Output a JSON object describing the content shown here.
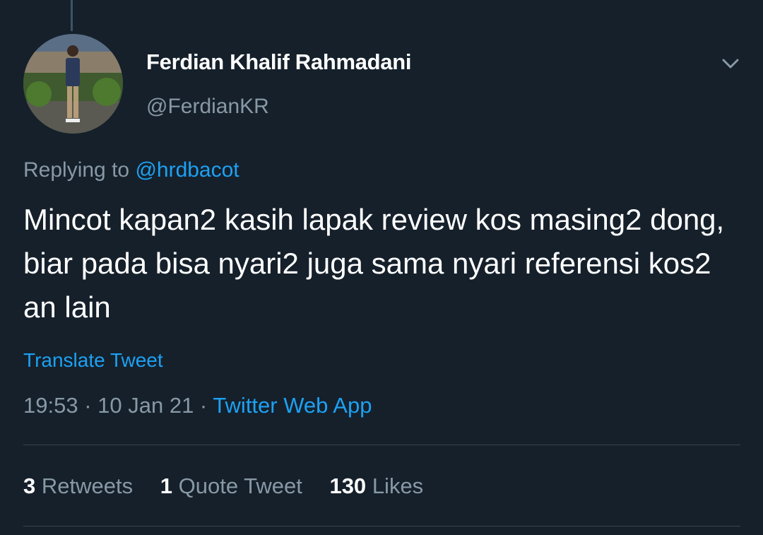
{
  "tweet": {
    "author": {
      "display_name": "Ferdian Khalif Rahmadani",
      "handle": "@FerdianKR"
    },
    "replying_to_prefix": "Replying to ",
    "replying_to": "@hrdbacot",
    "text": "Mincot kapan2 kasih lapak review kos masing2 dong, biar pada bisa nyari2 juga sama nyari referensi kos2 an lain",
    "translate_label": "Translate Tweet",
    "time": "19:53",
    "date": "10 Jan 21",
    "separator": " · ",
    "source": "Twitter Web App",
    "stats": {
      "retweets_count": "3",
      "retweets_label": "Retweets",
      "quotes_count": "1",
      "quotes_label": "Quote Tweet",
      "likes_count": "130",
      "likes_label": "Likes"
    }
  },
  "icons": {
    "menu": "chevron-down-icon"
  },
  "colors": {
    "background": "#15202b",
    "accent": "#1da1f2",
    "secondary_text": "#8899a6",
    "divider": "#38444d"
  }
}
